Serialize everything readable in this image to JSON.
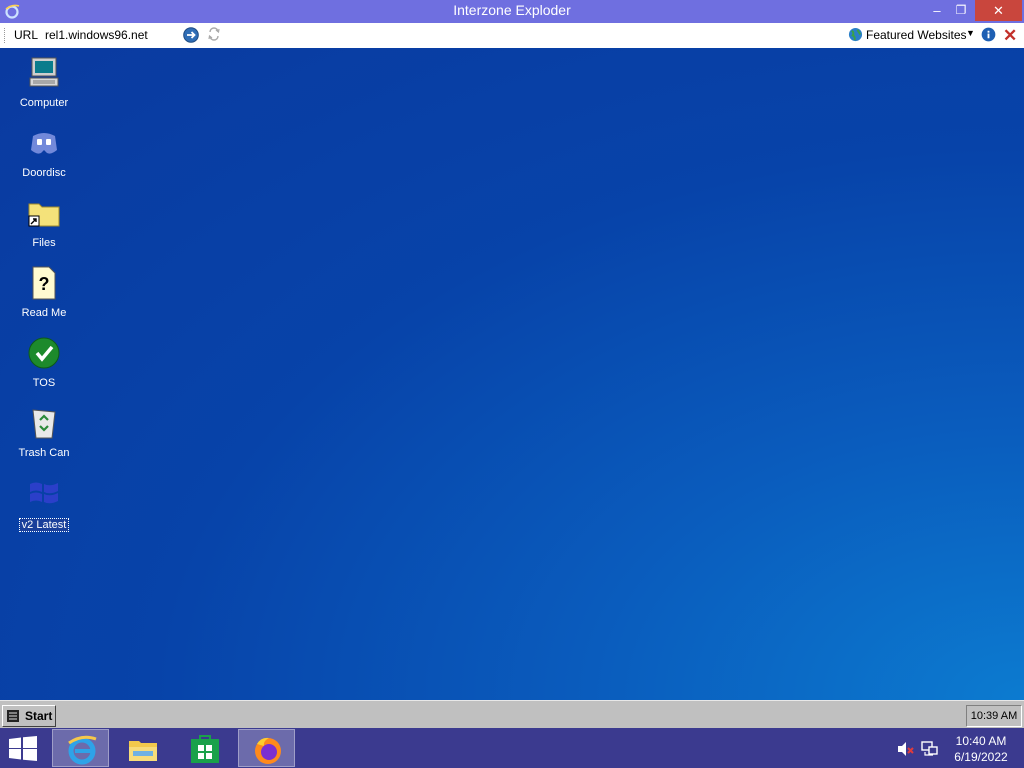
{
  "window": {
    "title": "Interzone Exploder",
    "minimize_glyph": "‒",
    "maximize_glyph": "❐",
    "close_glyph": "✕"
  },
  "addressbar": {
    "url_label": "URL",
    "url_value": "rel1.windows96.net",
    "featured_label": "Featured Websites"
  },
  "desktop": {
    "icons": [
      {
        "label": "Computer",
        "icon": "computer-icon"
      },
      {
        "label": "Doordisc",
        "icon": "doordisc-icon"
      },
      {
        "label": "Files",
        "icon": "folder-shortcut-icon"
      },
      {
        "label": "Read Me",
        "icon": "help-document-icon"
      },
      {
        "label": "TOS",
        "icon": "checkmark-icon"
      },
      {
        "label": "Trash Can",
        "icon": "recycle-bin-icon"
      },
      {
        "label": "v2 Latest",
        "icon": "windows-flag-icon",
        "selected": true
      }
    ]
  },
  "w96_taskbar": {
    "start_label": "Start",
    "clock": "10:39 AM"
  },
  "host_taskbar": {
    "apps": [
      {
        "name": "internet-explorer",
        "active": true
      },
      {
        "name": "file-explorer",
        "active": false
      },
      {
        "name": "store",
        "active": false
      },
      {
        "name": "firefox",
        "active": true
      }
    ],
    "time": "10:40 AM",
    "date": "6/19/2022"
  },
  "colors": {
    "titlebar": "#6f6fe0",
    "close_button": "#c9463d",
    "desktop": "#0a4cb0",
    "host_taskbar": "#3b3a8f"
  }
}
